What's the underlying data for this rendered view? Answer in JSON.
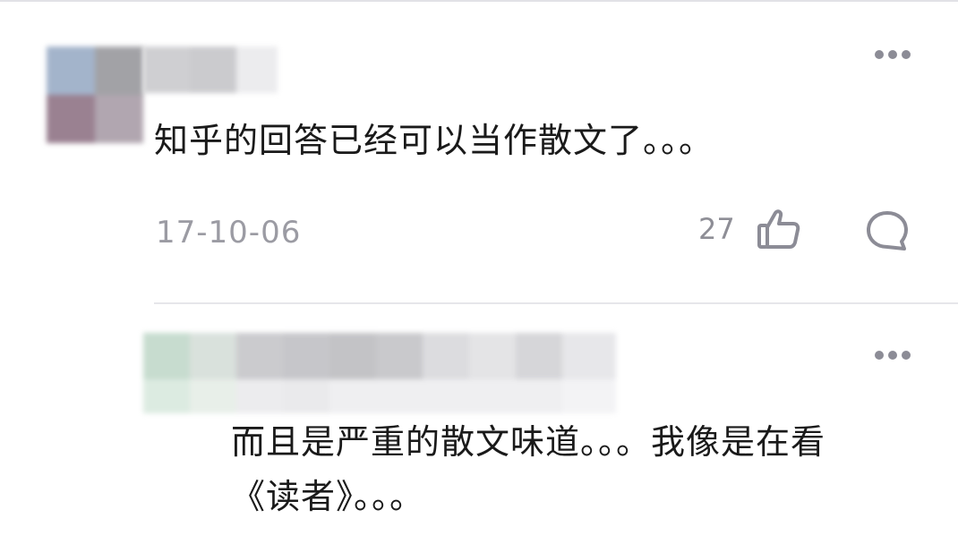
{
  "comments": [
    {
      "text": "知乎的回答已经可以当作散文了。。。",
      "date": "17-10-06",
      "likes": "27",
      "more_icon": "more-dots-icon",
      "like_icon": "thumbs-up-icon",
      "reply_icon": "comment-bubble-icon"
    },
    {
      "text_line1": "而且是严重的散文味道。。。我像是在看",
      "text_line2": "《读者》。。。",
      "more_icon": "more-dots-icon"
    }
  ],
  "colors": {
    "text": "#1a1a1a",
    "meta": "#9b9ba3",
    "icon": "#8c8c96",
    "divider": "#e6e6ea"
  }
}
